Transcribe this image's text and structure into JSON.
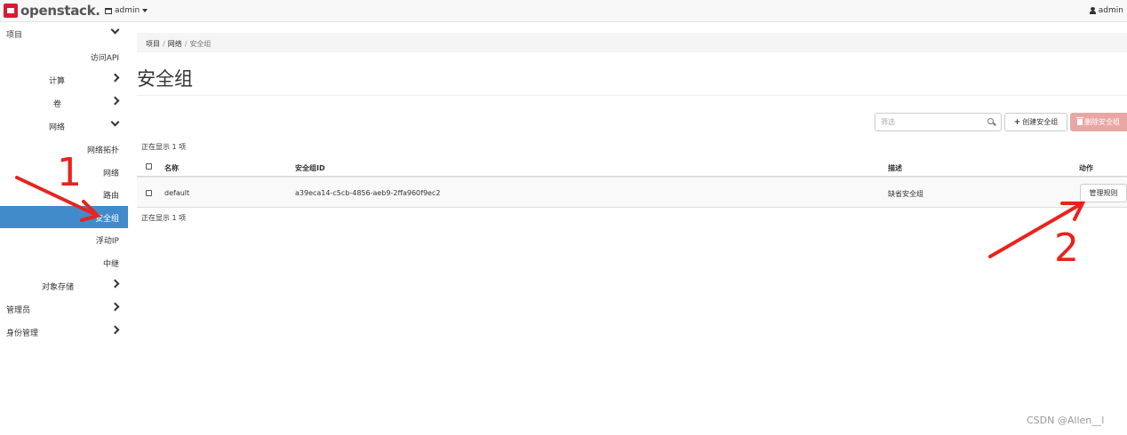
{
  "topbar": {
    "logo_text": "openstack",
    "logo_dot": ".",
    "project": "admin",
    "user": "admin"
  },
  "sidebar": {
    "items": [
      {
        "label": "项目",
        "chevron": "down"
      },
      {
        "label": "访问API"
      },
      {
        "label": "计算",
        "chevron": "right"
      },
      {
        "label": "卷",
        "chevron": "right"
      },
      {
        "label": "网络",
        "chevron": "down"
      },
      {
        "label": "网络拓扑"
      },
      {
        "label": "网络"
      },
      {
        "label": "路由"
      },
      {
        "label": "安全组",
        "active": true
      },
      {
        "label": "浮动IP"
      },
      {
        "label": "中继"
      },
      {
        "label": "对象存储",
        "chevron": "right"
      },
      {
        "label": "管理员",
        "chevron": "right"
      },
      {
        "label": "身份管理",
        "chevron": "right"
      }
    ]
  },
  "breadcrumb": {
    "items": [
      "项目",
      "网络",
      "安全组"
    ],
    "separator": "/"
  },
  "page": {
    "title": "安全组"
  },
  "toolbar": {
    "filter_placeholder": "筛选",
    "create_label": "创建安全组",
    "delete_label": "删除安全组"
  },
  "table": {
    "count_text": "正在显示 1 项",
    "columns": [
      "名称",
      "安全组ID",
      "描述",
      "动作"
    ],
    "rows": [
      {
        "name": "default",
        "id": "a39eca14-c5cb-4856-aeb9-2ffa960f9ec2",
        "description": "缺省安全组",
        "action": "管理规则"
      }
    ]
  },
  "annotations": {
    "label_1": "1",
    "label_2": "2",
    "color": "#e8231d"
  },
  "watermark": "CSDN @Allen__l",
  "colors": {
    "active_bg": "#428bca",
    "danger_disabled": "#e8a7a5",
    "logo_red": "#da1a32"
  }
}
